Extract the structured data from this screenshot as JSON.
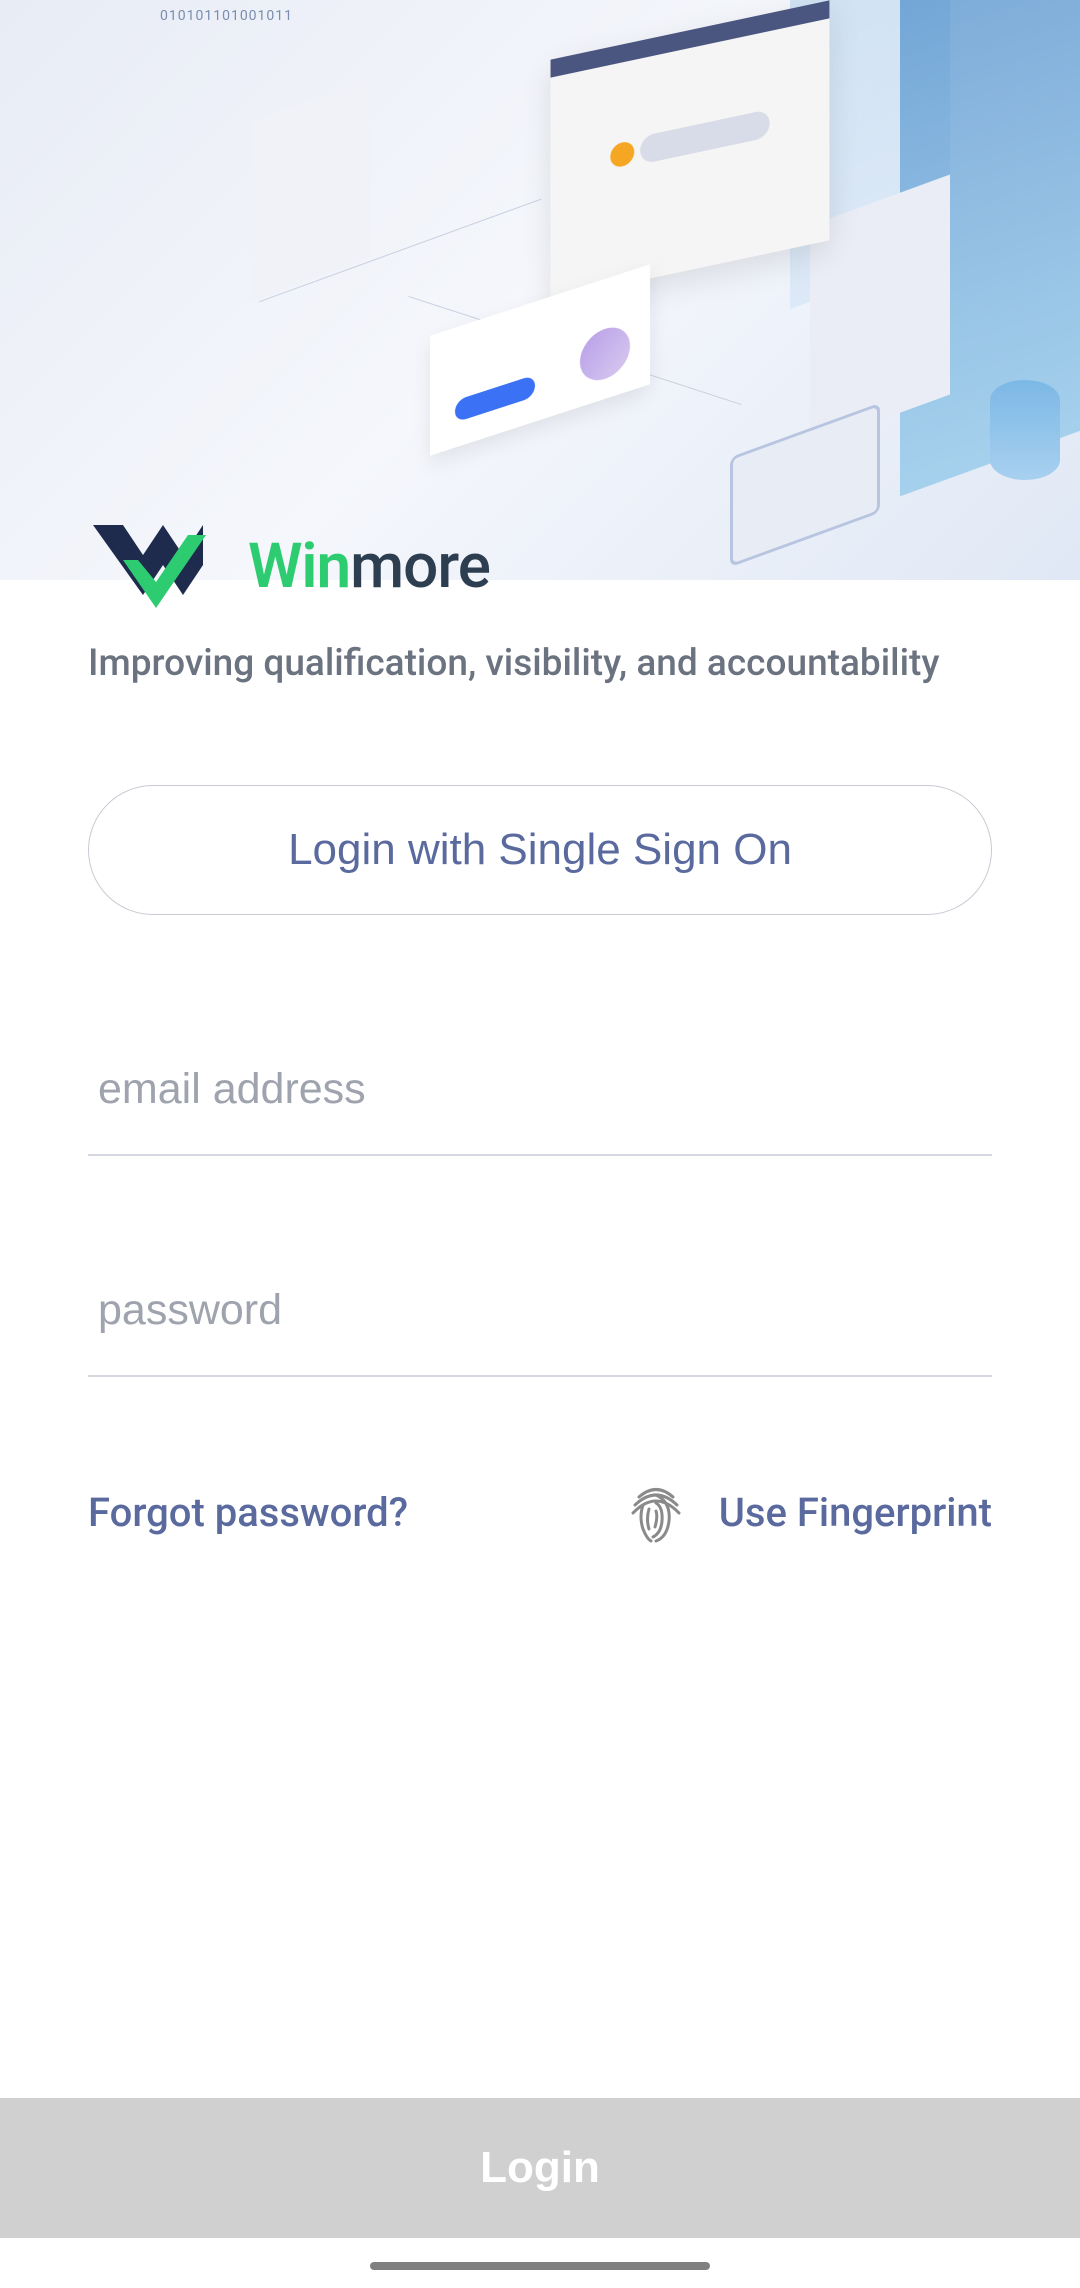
{
  "hero": {
    "binary_text": "010101101001011"
  },
  "brand": {
    "name_part1": "Win",
    "name_part2": "more",
    "tagline": "Improving qualification, visibility, and accountability"
  },
  "actions": {
    "sso_label": "Login with Single Sign On",
    "forgot_password_label": "Forgot password?",
    "fingerprint_label": "Use Fingerprint",
    "login_label": "Login"
  },
  "inputs": {
    "email_placeholder": "email address",
    "email_value": "",
    "password_placeholder": "password",
    "password_value": ""
  },
  "colors": {
    "brand_green": "#2ecc71",
    "brand_navy": "#2c3e50",
    "accent_blue": "#5a6a9e",
    "disabled_gray": "#d0d0d0"
  }
}
